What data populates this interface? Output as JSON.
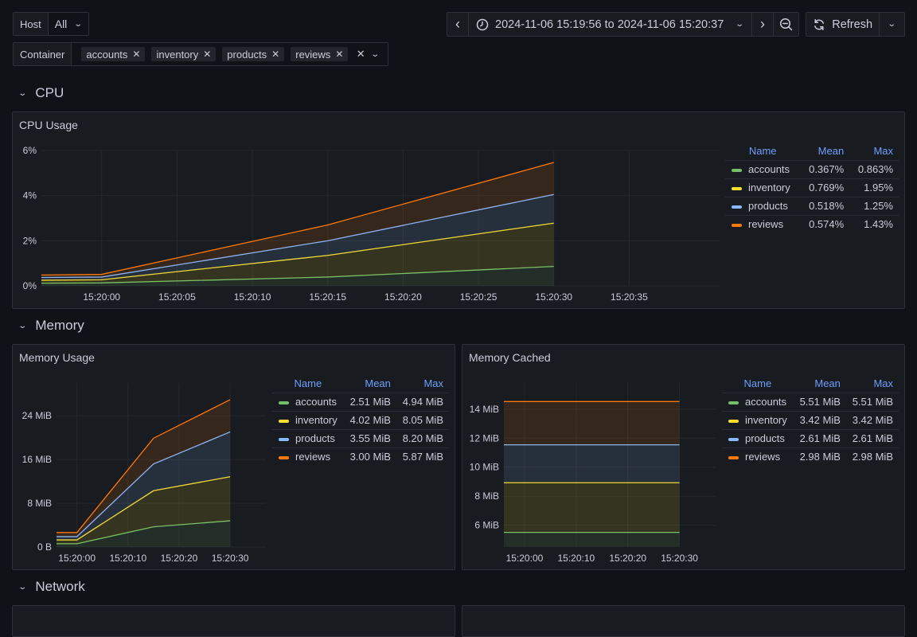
{
  "variables": {
    "host": {
      "label": "Host",
      "value": "All"
    },
    "container": {
      "label": "Container",
      "values": [
        "accounts",
        "inventory",
        "products",
        "reviews"
      ]
    }
  },
  "toolbar": {
    "time_range": "2024-11-06 15:19:56 to 2024-11-06 15:20:37",
    "refresh_label": "Refresh"
  },
  "icons": {
    "back": "‹",
    "forward": "›",
    "clock": "clock-icon",
    "zoom_out": "zoom-out-icon",
    "refresh": "refresh-icon",
    "remove": "✕",
    "chevron": "⌄"
  },
  "colors": {
    "accounts": "#73bf69",
    "inventory": "#fade2a",
    "products": "#8ab8ff",
    "reviews": "#ff780a",
    "legend_header": "#6e9fff"
  },
  "rows": [
    {
      "title": "CPU"
    },
    {
      "title": "Memory"
    },
    {
      "title": "Network"
    }
  ],
  "legend_headers": {
    "name": "Name",
    "mean": "Mean",
    "max": "Max"
  },
  "panels": {
    "cpu": {
      "title": "CPU Usage",
      "legend": [
        {
          "name": "accounts",
          "mean": "0.367%",
          "max": "0.863%"
        },
        {
          "name": "inventory",
          "mean": "0.769%",
          "max": "1.95%"
        },
        {
          "name": "products",
          "mean": "0.518%",
          "max": "1.25%"
        },
        {
          "name": "reviews",
          "mean": "0.574%",
          "max": "1.43%"
        }
      ]
    },
    "memory_usage": {
      "title": "Memory Usage",
      "legend": [
        {
          "name": "accounts",
          "mean": "2.51 MiB",
          "max": "4.94 MiB"
        },
        {
          "name": "inventory",
          "mean": "4.02 MiB",
          "max": "8.05 MiB"
        },
        {
          "name": "products",
          "mean": "3.55 MiB",
          "max": "8.20 MiB"
        },
        {
          "name": "reviews",
          "mean": "3.00 MiB",
          "max": "5.87 MiB"
        }
      ]
    },
    "memory_cached": {
      "title": "Memory Cached",
      "legend": [
        {
          "name": "accounts",
          "mean": "5.51 MiB",
          "max": "5.51 MiB"
        },
        {
          "name": "inventory",
          "mean": "3.42 MiB",
          "max": "3.42 MiB"
        },
        {
          "name": "products",
          "mean": "2.61 MiB",
          "max": "2.61 MiB"
        },
        {
          "name": "reviews",
          "mean": "2.98 MiB",
          "max": "2.98 MiB"
        }
      ]
    }
  },
  "chart_data": [
    {
      "id": "cpu",
      "type": "area",
      "stacked": true,
      "title": "CPU Usage",
      "xlabel": "",
      "ylabel": "",
      "x_seconds": [
        -4,
        0,
        15,
        30
      ],
      "x_range_seconds": [
        -4,
        41
      ],
      "x_ticks": [
        "15:20:00",
        "15:20:05",
        "15:20:10",
        "15:20:15",
        "15:20:20",
        "15:20:25",
        "15:20:30",
        "15:20:35"
      ],
      "x_tick_seconds": [
        0,
        5,
        10,
        15,
        20,
        25,
        30,
        35
      ],
      "y_ticks": [
        "0%",
        "2%",
        "4%",
        "6%"
      ],
      "y_tick_values": [
        0,
        2,
        4,
        6
      ],
      "ylim": [
        0,
        6
      ],
      "grid": true,
      "legend_position": "right",
      "series": [
        {
          "name": "accounts",
          "values": [
            0.12,
            0.13,
            0.39,
            0.86
          ]
        },
        {
          "name": "inventory",
          "values": [
            0.13,
            0.14,
            0.96,
            1.92
          ]
        },
        {
          "name": "products",
          "values": [
            0.12,
            0.12,
            0.65,
            1.27
          ]
        },
        {
          "name": "reviews",
          "values": [
            0.11,
            0.12,
            0.7,
            1.42
          ]
        }
      ]
    },
    {
      "id": "memory_usage",
      "type": "area",
      "stacked": true,
      "title": "Memory Usage",
      "xlabel": "",
      "ylabel": "",
      "x_seconds": [
        -4,
        0,
        15,
        30
      ],
      "x_range_seconds": [
        -4,
        37
      ],
      "x_ticks": [
        "15:20:00",
        "15:20:10",
        "15:20:20",
        "15:20:30"
      ],
      "x_tick_seconds": [
        0,
        10,
        20,
        30
      ],
      "y_ticks": [
        "0 B",
        "8 MiB",
        "16 MiB",
        "24 MiB"
      ],
      "y_tick_values": [
        0,
        8,
        16,
        24
      ],
      "ylim": [
        0,
        30
      ],
      "grid": true,
      "legend_position": "right",
      "series": [
        {
          "name": "accounts",
          "values": [
            0.6,
            0.6,
            3.7,
            4.8
          ]
        },
        {
          "name": "inventory",
          "values": [
            0.7,
            0.7,
            6.6,
            8.05
          ]
        },
        {
          "name": "products",
          "values": [
            0.6,
            0.6,
            4.9,
            8.2
          ]
        },
        {
          "name": "reviews",
          "values": [
            0.75,
            0.75,
            4.7,
            5.9
          ]
        }
      ]
    },
    {
      "id": "memory_cached",
      "type": "area",
      "stacked": true,
      "title": "Memory Cached",
      "xlabel": "",
      "ylabel": "",
      "x_seconds": [
        -4,
        0,
        15,
        30
      ],
      "x_range_seconds": [
        -4,
        37
      ],
      "x_ticks": [
        "15:20:00",
        "15:20:10",
        "15:20:20",
        "15:20:30"
      ],
      "x_tick_seconds": [
        0,
        10,
        20,
        30
      ],
      "y_ticks": [
        "6 MiB",
        "8 MiB",
        "10 MiB",
        "12 MiB",
        "14 MiB"
      ],
      "y_tick_values": [
        6,
        8,
        10,
        12,
        14
      ],
      "ylim": [
        4.5,
        15.8
      ],
      "grid": true,
      "legend_position": "right",
      "series": [
        {
          "name": "accounts",
          "values": [
            5.51,
            5.51,
            5.51,
            5.51
          ]
        },
        {
          "name": "inventory",
          "values": [
            3.42,
            3.42,
            3.42,
            3.42
          ]
        },
        {
          "name": "products",
          "values": [
            2.61,
            2.61,
            2.61,
            2.61
          ]
        },
        {
          "name": "reviews",
          "values": [
            2.98,
            2.98,
            2.98,
            2.98
          ]
        }
      ]
    }
  ]
}
